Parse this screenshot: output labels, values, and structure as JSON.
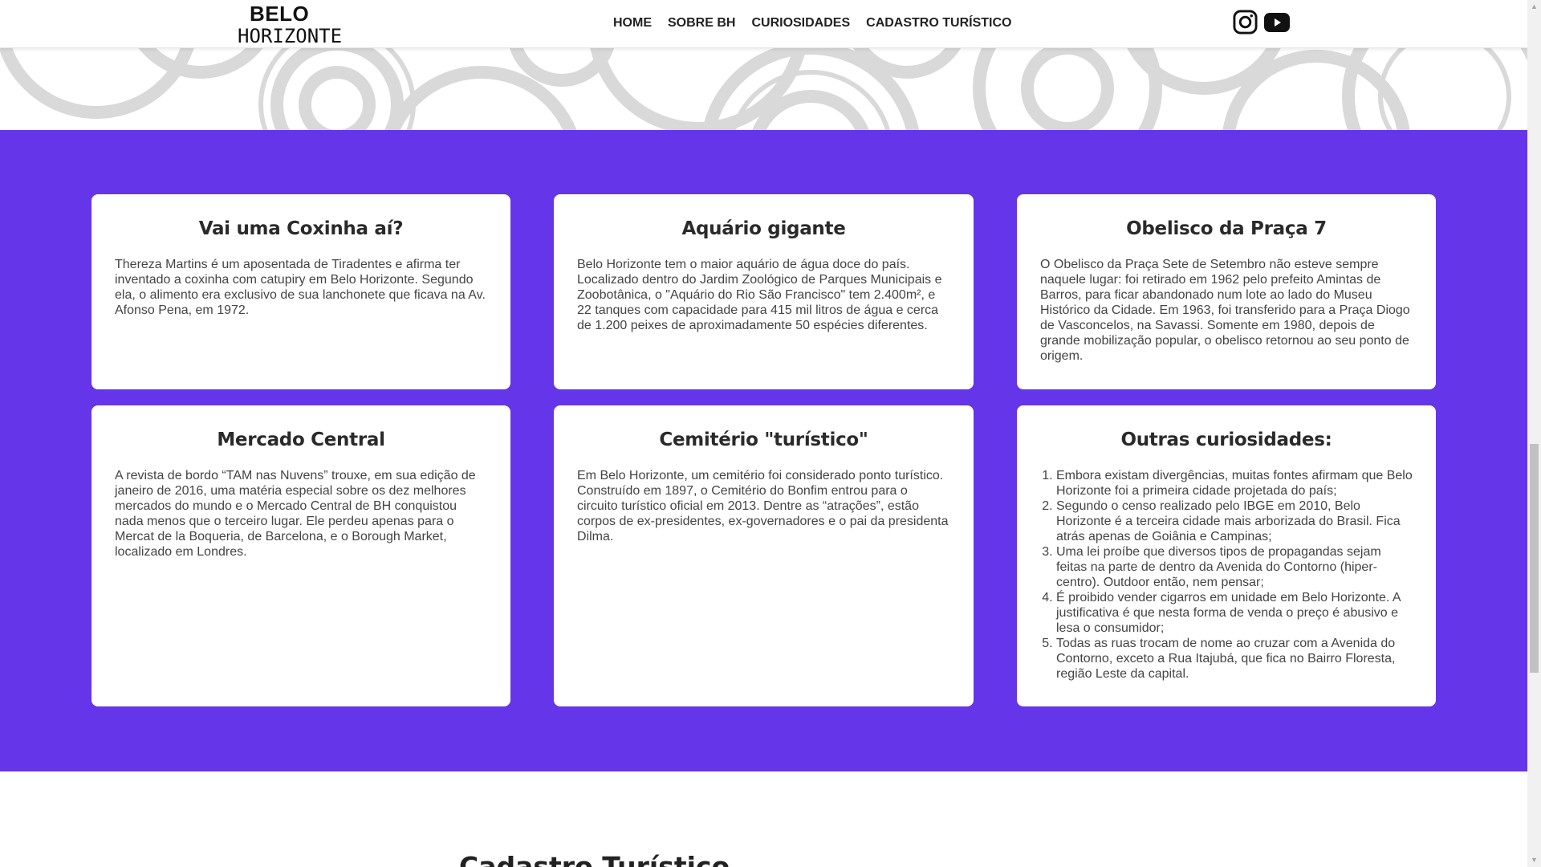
{
  "header": {
    "logo_top": "BELO",
    "logo_bottom": "HORIZONTE",
    "nav": [
      {
        "label": "HOME"
      },
      {
        "label": "SOBRE BH"
      },
      {
        "label": "CURIOSIDADES"
      },
      {
        "label": "CADASTRO TURÍSTICO"
      }
    ],
    "social_icons": [
      "instagram-icon",
      "youtube-icon"
    ]
  },
  "colors": {
    "section_background": "#6535e9",
    "card_background": "#ffffff",
    "pattern_color": "#d9d9d9"
  },
  "cards": [
    {
      "title": "Vai uma Coxinha aí?",
      "text": "Thereza Martins é um aposentada de Tiradentes e afirma ter inventado a coxinha com catupiry em Belo Horizonte. Segundo ela, o alimento era exclusivo de sua lanchonete que ficava na Av. Afonso Pena, em 1972."
    },
    {
      "title": "Aquário gigante",
      "text": "Belo Horizonte tem o maior aquário de água doce do país. Localizado dentro do Jardim Zoológico de Parques Municipais e Zoobotânica, o \"Aquário do Rio São Francisco\" tem 2.400m², e 22 tanques com capacidade para 415 mil litros de água e cerca de 1.200 peixes de aproximadamente 50 espécies diferentes."
    },
    {
      "title": "Obelisco da Praça 7",
      "text": "O Obelisco da Praça Sete de Setembro não esteve sempre naquele lugar: foi retirado em 1962 pelo prefeito Amintas de Barros, para ficar abandonado num lote ao lado do Museu Histórico da Cidade. Em 1963, foi transferido para a Praça Diogo de Vasconcelos, na Savassi. Somente em 1980, depois de grande mobilização popular, o obelisco retornou ao seu ponto de origem."
    },
    {
      "title": "Mercado Central",
      "text": "A revista de bordo “TAM nas Nuvens” trouxe, em sua edição de janeiro de 2016, uma matéria especial sobre os dez melhores mercados do mundo e o Mercado Central de BH conquistou nada menos que o terceiro lugar. Ele perdeu apenas para o Mercat de la Boqueria, de Barcelona, e o Borough Market, localizado em Londres."
    },
    {
      "title": "Cemitério \"turístico\"",
      "text": "Em Belo Horizonte, um cemitério foi considerado ponto turístico. Construído em 1897, o Cemitério do Bonfim entrou para o circuito turístico oficial em 2013. Dentre as “atrações”, estão corpos de ex-presidentes, ex-governadores e o pai da presidenta Dilma."
    },
    {
      "title": "Outras curiosidades:",
      "items": [
        "Embora existam divergências, muitas fontes afirmam que Belo Horizonte foi a primeira cidade projetada do país;",
        "Segundo o censo realizado pelo IBGE em 2010, Belo Horizonte é a terceira cidade mais arborizada do Brasil. Fica atrás apenas de Goiânia e Campinas;",
        "Uma lei proíbe que diversos tipos de propagandas sejam feitas na parte de dentro da Avenida do Contorno (hiper-centro). Outdoor então, nem pensar;",
        "É proibido vender cigarros em unidade em Belo Horizonte. A justificativa é que nesta forma de venda o preço é abusivo e lesa o consumidor;",
        "Todas as ruas trocam de nome ao cruzar com a Avenida do Contorno, exceto a Rua Itajubá, que fica no Bairro Floresta, região Leste da capital."
      ]
    }
  ],
  "next_section_title": "Cadastro Turístico"
}
